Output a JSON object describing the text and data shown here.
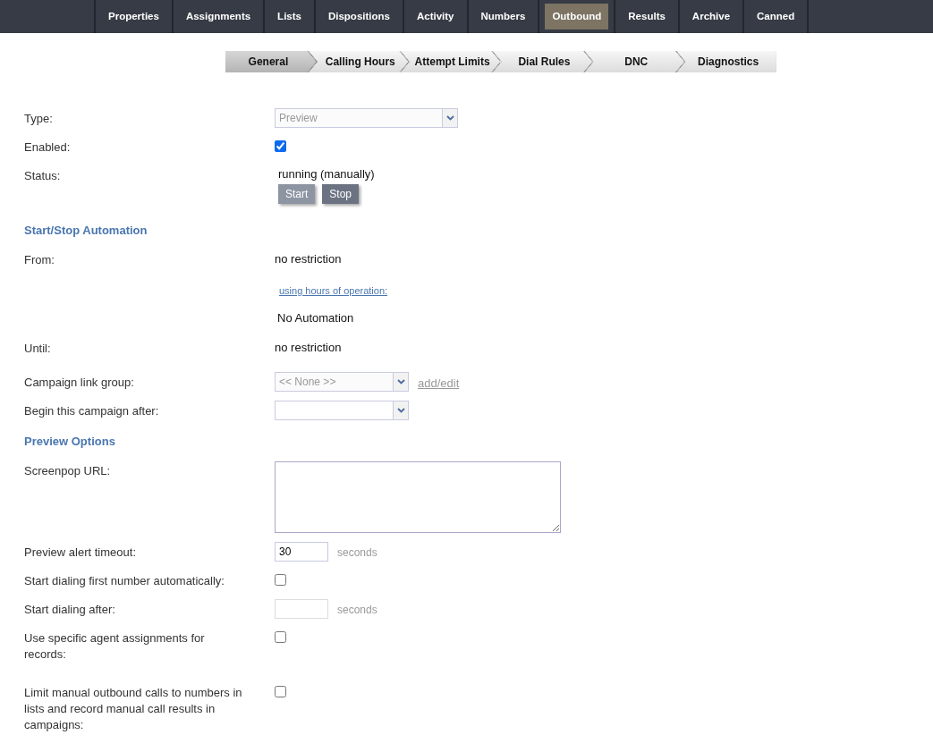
{
  "top_nav": [
    {
      "label": "Properties",
      "selected": false
    },
    {
      "label": "Assignments",
      "selected": false
    },
    {
      "label": "Lists",
      "selected": false
    },
    {
      "label": "Dispositions",
      "selected": false
    },
    {
      "label": "Activity",
      "selected": false
    },
    {
      "label": "Numbers",
      "selected": false
    },
    {
      "label": "Outbound",
      "selected": true
    },
    {
      "label": "Results",
      "selected": false
    },
    {
      "label": "Archive",
      "selected": false
    },
    {
      "label": "Canned",
      "selected": false
    }
  ],
  "steps": [
    {
      "label": "General",
      "selected": true
    },
    {
      "label": "Calling Hours",
      "selected": false
    },
    {
      "label": "Attempt Limits",
      "selected": false
    },
    {
      "label": "Dial Rules",
      "selected": false
    },
    {
      "label": "DNC",
      "selected": false
    },
    {
      "label": "Diagnostics",
      "selected": false
    }
  ],
  "rows": [
    {
      "kind": "select",
      "label": "Type:",
      "value": "Preview",
      "disabled": true
    },
    {
      "kind": "checkbox",
      "label": "Enabled:",
      "checked": true
    },
    {
      "kind": "status",
      "label": "Status:",
      "value": "running (manually)",
      "buttons": [
        {
          "label": "Start",
          "disabled": true
        },
        {
          "label": "Stop",
          "disabled": false
        }
      ]
    },
    {
      "kind": "heading",
      "label": "Start/Stop Automation"
    },
    {
      "kind": "text",
      "label": "From:",
      "value": "no restriction"
    },
    {
      "kind": "link",
      "value": "using hours of operation:"
    },
    {
      "kind": "note",
      "value": "No Automation"
    },
    {
      "kind": "text",
      "label": "Until:",
      "value": "no restriction"
    },
    {
      "kind": "select",
      "label": "Campaign link group:",
      "value": "<< None >>",
      "disabled": true,
      "link": "add/edit"
    },
    {
      "kind": "select",
      "label": "Begin this campaign after:",
      "disabled": false
    },
    {
      "kind": "heading",
      "label": "Preview Options"
    },
    {
      "kind": "textarea",
      "label": "Screenpop URL:"
    },
    {
      "kind": "number",
      "label": "Preview alert timeout:",
      "value": "30",
      "unit": "seconds",
      "disabled": false
    },
    {
      "kind": "checkbox",
      "label": "Start dialing first number automatically:",
      "checked": false
    },
    {
      "kind": "number",
      "label": "Start dialing after:",
      "unit": "seconds",
      "disabled": true
    },
    {
      "kind": "checkbox",
      "label": "Use specific agent assignments for records:",
      "checked": false
    },
    {
      "kind": "checkbox",
      "label": "Limit manual outbound calls to numbers in lists and record manual call results in campaigns:",
      "checked": false
    }
  ]
}
